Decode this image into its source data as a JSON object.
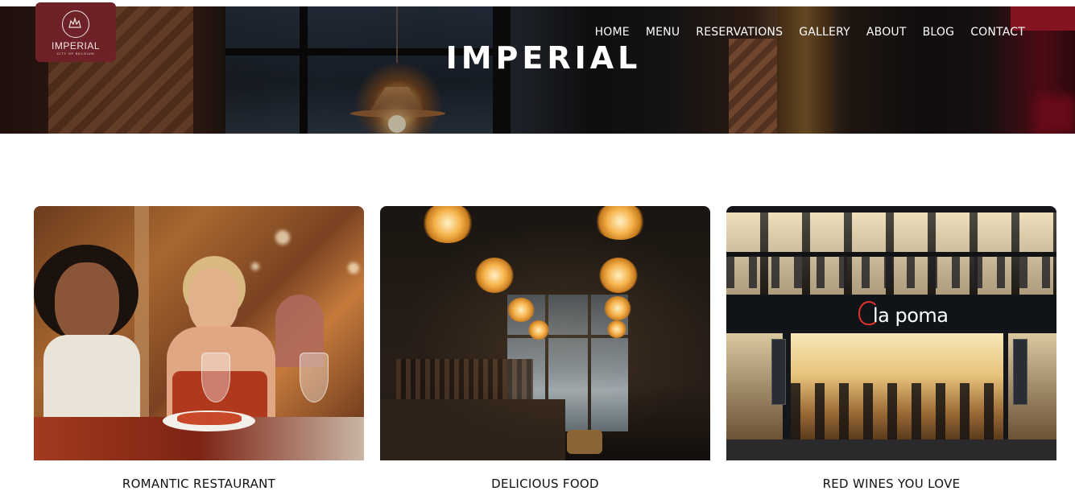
{
  "brand": {
    "logo_name": "IMPERIAL",
    "logo_tagline": "CITY OF BELGIUM"
  },
  "nav": {
    "items": [
      "HOME",
      "MENU",
      "RESERVATIONS",
      "GALLERY",
      "ABOUT",
      "BLOG",
      "CONTACT"
    ]
  },
  "hero": {
    "title": "IMPERIAL"
  },
  "cards": [
    {
      "caption": "ROMANTIC RESTAURANT",
      "image_alt": "two women eating at a restaurant"
    },
    {
      "caption": "DELICIOUS FOOD",
      "image_alt": "dark restaurant interior with hanging lamps"
    },
    {
      "caption": "RED WINES YOU LOVE",
      "image_alt": "la poma restaurant storefront at night"
    }
  ],
  "storefront_sign": "la poma",
  "colors": {
    "logo_bg": "#6e2228",
    "nav_text": "#ffffff",
    "caption_text": "#111111"
  }
}
